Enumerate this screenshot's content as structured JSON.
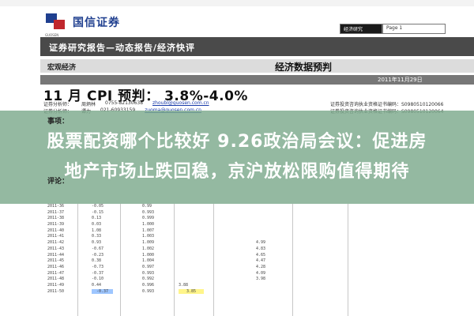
{
  "header": {
    "logo_text": "国信证券",
    "logo_en": "GUOSEN",
    "top_right_label": "经济研究",
    "top_right_page": "Page 1"
  },
  "band_title": "证券研究报告—动态报告/经济快评",
  "subbar": {
    "left": "宏观经济",
    "right": "经济数据预判"
  },
  "report_date": "2011年11月29日",
  "cpi_title": "11 月  CPI 预判：  3.8%-4.0%",
  "analysts": [
    {
      "role": "证券分析师：",
      "name": "周炳林",
      "phone": "0755-82130638",
      "email": "zhoubl@guosen.com.cn",
      "cert": "证券投资咨询执业资格证书编码：S0980510120066"
    },
    {
      "role": "证券分析师：",
      "name": "谭力",
      "phone": "021-60933159",
      "email": "zuoma@guosen.com.cn",
      "cert": "证券投资咨询执业资格证书编码：S0980510120064"
    }
  ],
  "overlay": {
    "label1": "事项：",
    "label2": "评论：",
    "headline_line1": "股票配资哪个比较好 9.26政治局会议：促进房",
    "headline_line2": "地产市场止跌回稳，京沪放松限购值得期待"
  },
  "table_rows": [
    {
      "date": "2011-36",
      "v1": "-0.05",
      "v2": "0.99",
      "v3": "",
      "v4": "",
      "v5": ""
    },
    {
      "date": "2011-37",
      "v1": "-0.15",
      "v2": "0.993",
      "v3": "",
      "v4": "",
      "v5": ""
    },
    {
      "date": "2011-38",
      "v1": "0.13",
      "v2": "0.999",
      "v3": "",
      "v4": "",
      "v5": ""
    },
    {
      "date": "2011-39",
      "v1": "0.03",
      "v2": "1.000",
      "v3": "",
      "v4": "",
      "v5": ""
    },
    {
      "date": "2011-40",
      "v1": "1.08",
      "v2": "1.007",
      "v3": "",
      "v4": "",
      "v5": ""
    },
    {
      "date": "2011-41",
      "v1": "0.33",
      "v2": "1.003",
      "v3": "",
      "v4": "",
      "v5": ""
    },
    {
      "date": "2011-42",
      "v1": "0.93",
      "v2": "1.009",
      "v3": "",
      "v4": "4.99",
      "v5": ""
    },
    {
      "date": "2011-43",
      "v1": "-0.67",
      "v2": "1.002",
      "v3": "",
      "v4": "4.83",
      "v5": ""
    },
    {
      "date": "2011-44",
      "v1": "-0.23",
      "v2": "1.000",
      "v3": "",
      "v4": "4.65",
      "v5": ""
    },
    {
      "date": "2011-45",
      "v1": "0.38",
      "v2": "1.004",
      "v3": "",
      "v4": "4.47",
      "v5": ""
    },
    {
      "date": "2011-46",
      "v1": "-0.73",
      "v2": "0.997",
      "v3": "",
      "v4": "4.28",
      "v5": ""
    },
    {
      "date": "2011-47",
      "v1": "-0.37",
      "v2": "0.993",
      "v3": "",
      "v4": "4.09",
      "v5": ""
    },
    {
      "date": "2011-48",
      "v1": "-0.10",
      "v2": "0.992",
      "v3": "",
      "v4": "3.98",
      "v5": ""
    },
    {
      "date": "2011-49",
      "v1": "0.44",
      "v2": "0.996",
      "v3": "3.88",
      "v4": "",
      "v5": ""
    },
    {
      "date": "2011-50",
      "v1": "-0.37",
      "v2": "0.993",
      "v3": "3.85",
      "v4": "",
      "v5": ""
    }
  ]
}
